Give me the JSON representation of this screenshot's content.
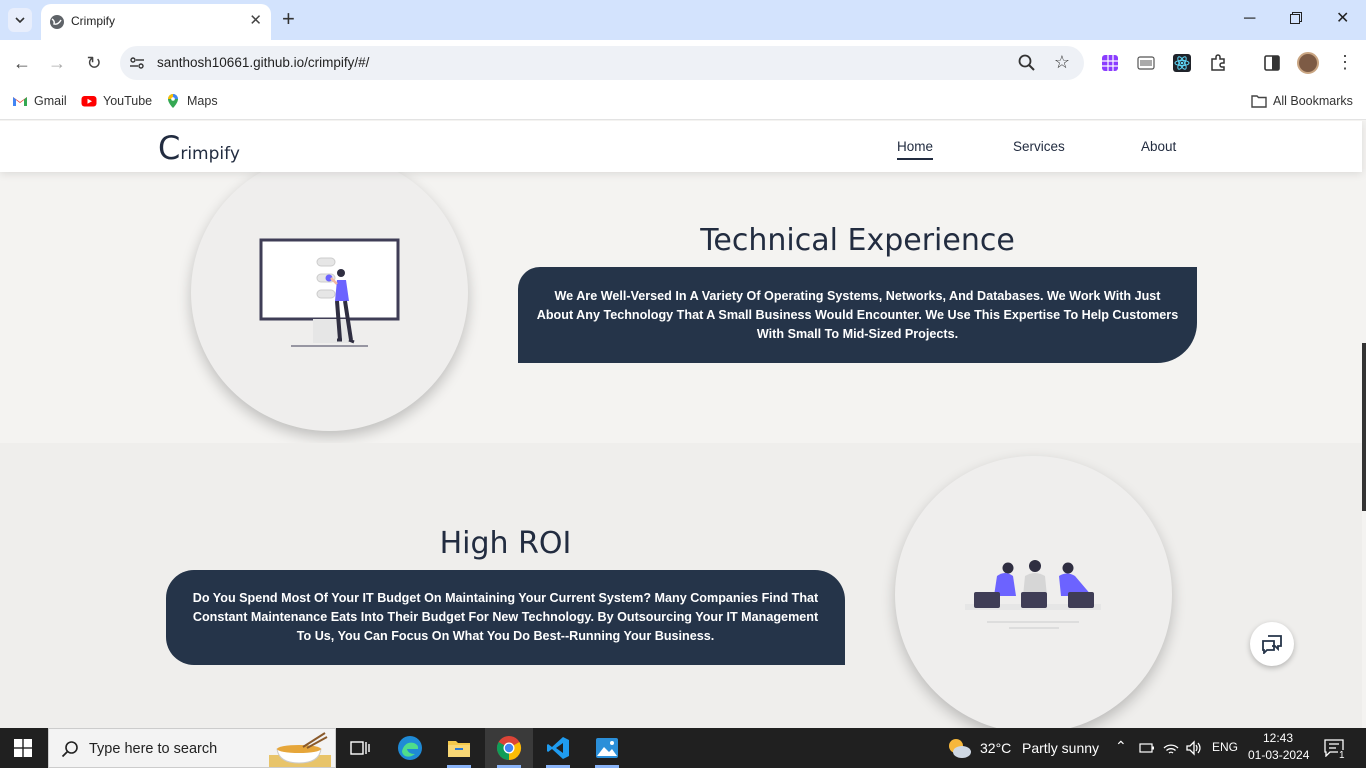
{
  "browser": {
    "tab": {
      "title": "Crimpify",
      "close": "✕"
    },
    "new_tab": "+",
    "url": "santhosh10661.github.io/crimpify/#/",
    "bookmarks": [
      {
        "label": "Gmail",
        "icon": "gmail-icon"
      },
      {
        "label": "YouTube",
        "icon": "youtube-icon"
      },
      {
        "label": "Maps",
        "icon": "maps-icon"
      }
    ],
    "all_bookmarks": "All Bookmarks"
  },
  "site": {
    "logo_initial": "C",
    "logo_rest": "rimpify",
    "nav": [
      {
        "label": "Home",
        "active": true
      },
      {
        "label": "Services",
        "active": false
      },
      {
        "label": "About",
        "active": false
      }
    ],
    "sections": [
      {
        "heading": "Technical Experience",
        "text": "We Are Well-Versed In A Variety Of Operating Systems, Networks, And Databases. We Work With Just About Any Technology That A Small Business Would Encounter. We Use This Expertise To Help Customers With Small To Mid-Sized Projects."
      },
      {
        "heading": "High ROI",
        "text": "Do You Spend Most Of Your IT Budget On Maintaining Your Current System? Many Companies Find That Constant Maintenance Eats Into Their Budget For New Technology. By Outsourcing Your IT Management To Us, You Can Focus On What You Do Best--Running Your Business."
      }
    ],
    "colors": {
      "dark_navy": "#253449",
      "accent_purple": "#6c63ff"
    }
  },
  "taskbar": {
    "search_placeholder": "Type here to search",
    "weather_temp": "32°C",
    "weather_text": "Partly sunny",
    "language": "ENG",
    "time": "12:43",
    "date": "01-03-2024",
    "notification_count": "1"
  }
}
